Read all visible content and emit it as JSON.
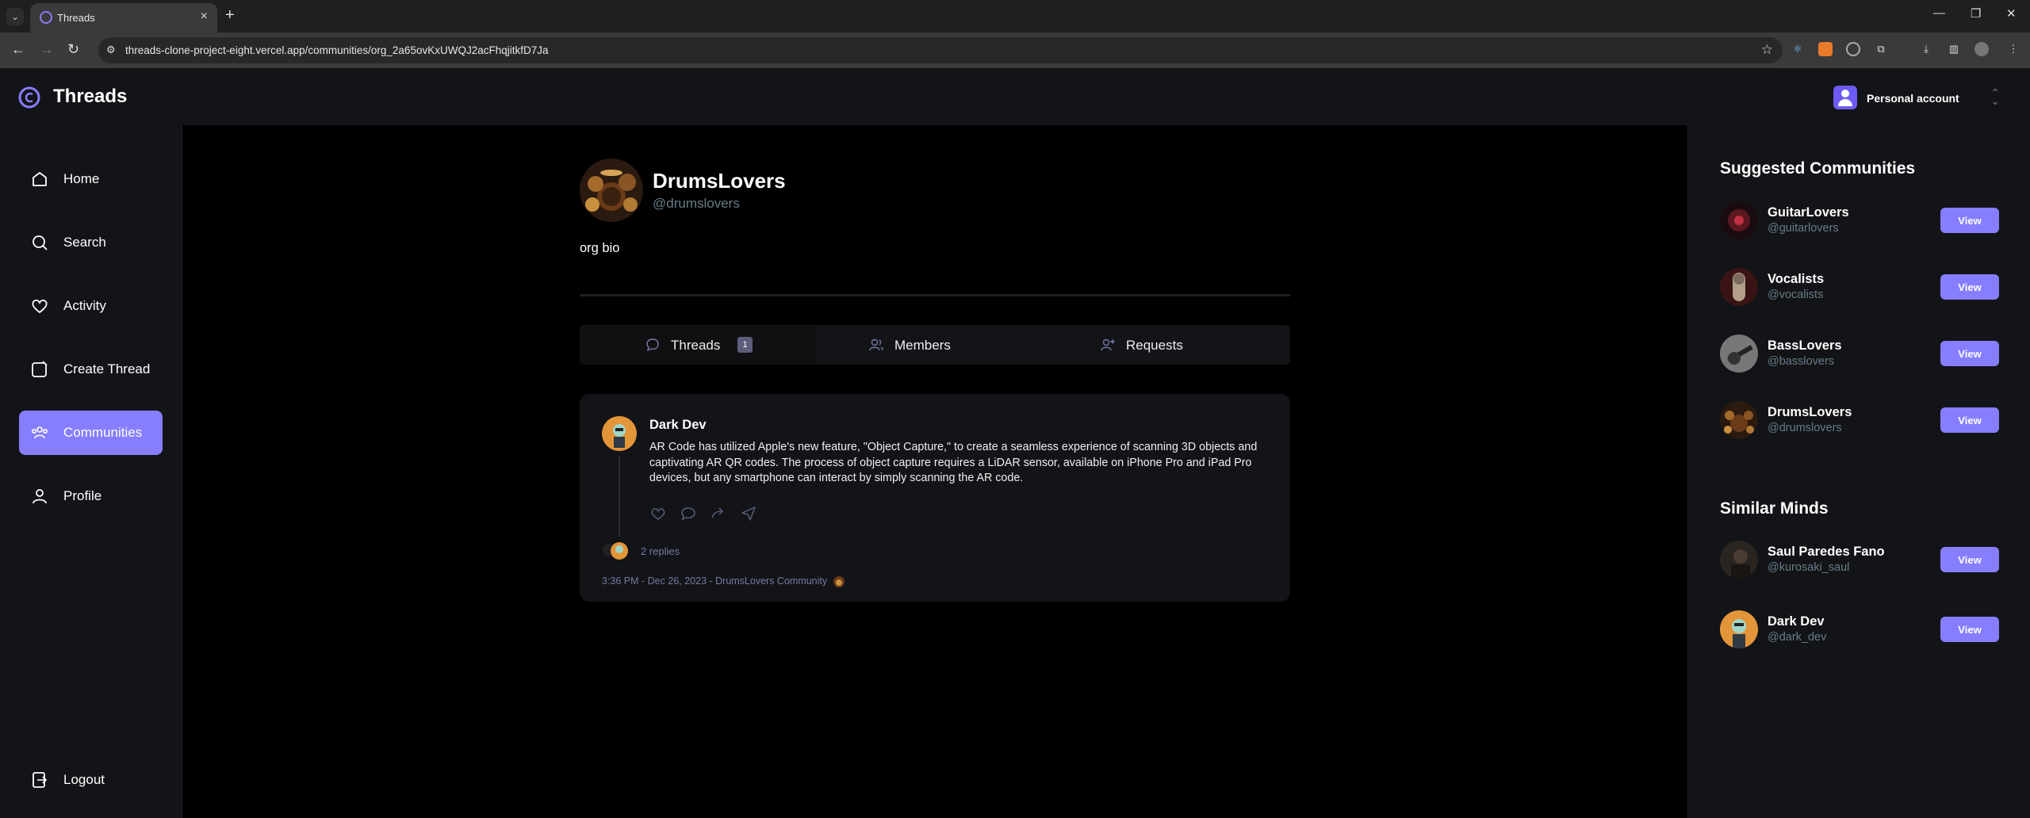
{
  "browser": {
    "tab_title": "Threads",
    "url": "threads-clone-project-eight.vercel.app/communities/org_2a65ovKxUWQJ2acFhqjitkfD7Ja"
  },
  "header": {
    "logo_text": "Threads",
    "account_label": "Personal account"
  },
  "sidebar": {
    "items": [
      {
        "label": "Home",
        "icon": "home-icon"
      },
      {
        "label": "Search",
        "icon": "search-icon"
      },
      {
        "label": "Activity",
        "icon": "heart-icon"
      },
      {
        "label": "Create Thread",
        "icon": "create-icon"
      },
      {
        "label": "Communities",
        "icon": "community-icon",
        "active": true
      },
      {
        "label": "Profile",
        "icon": "user-icon"
      }
    ],
    "logout_label": "Logout"
  },
  "community": {
    "name": "DrumsLovers",
    "handle": "@drumslovers",
    "bio": "org bio"
  },
  "tabs": [
    {
      "label": "Threads",
      "badge": "1"
    },
    {
      "label": "Members"
    },
    {
      "label": "Requests"
    }
  ],
  "thread": {
    "author": "Dark Dev",
    "text": "AR Code has utilized Apple's new feature, \"Object Capture,\" to create a seamless experience of scanning 3D objects and captivating AR QR codes. The process of object capture requires a LiDAR sensor, available on iPhone Pro and iPad Pro devices, but any smartphone can interact by simply scanning the AR code.",
    "replies": "2 replies",
    "footer": "3:36 PM - Dec 26, 2023 - DrumsLovers Community"
  },
  "rightbar": {
    "suggested_title": "Suggested Communities",
    "suggested": [
      {
        "name": "GuitarLovers",
        "handle": "@guitarlovers"
      },
      {
        "name": "Vocalists",
        "handle": "@vocalists"
      },
      {
        "name": "BassLovers",
        "handle": "@basslovers"
      },
      {
        "name": "DrumsLovers",
        "handle": "@drumslovers"
      }
    ],
    "similar_title": "Similar Minds",
    "similar": [
      {
        "name": "Saul Paredes Fano",
        "handle": "@kurosaki_saul"
      },
      {
        "name": "Dark Dev",
        "handle": "@dark_dev"
      }
    ],
    "view_label": "View"
  },
  "colors": {
    "accent": "#877eff",
    "muted": "#697c89",
    "panel": "#121417"
  }
}
